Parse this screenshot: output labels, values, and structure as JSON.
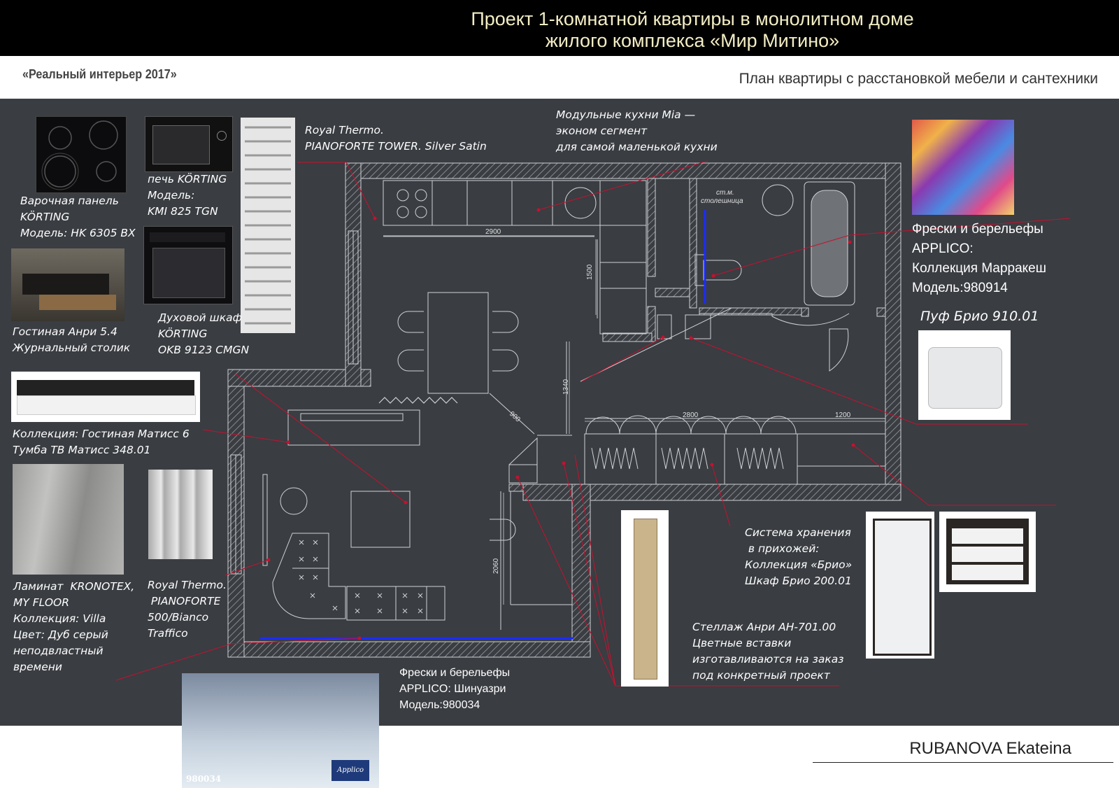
{
  "header": {
    "title_line1": "Проект 1-комнатной квартиры в монолитном доме",
    "title_line2": "жилого комплекса «Мир Митино»",
    "subtitle_left": "«Реальный интерьер 2017»",
    "subtitle_right": "План квартиры с расстановкой мебели и сантехники"
  },
  "labels": {
    "hob": "Варочная панель\nKÖRTING\nМодель: HK 6305 BX",
    "microwave": "печь KÖRTING\nМодель:\nKMI 825 TGN",
    "oven": "Духовой шкаф\nKÖRTING\nOKB 9123 CMGN",
    "radiator_tower": "Royal Thermo.\nPIANOFORTE TOWER. Silver Satin",
    "kitchen": "Модульные кухни Mia —\nэконом сегмент\nдля самой маленькой кухни",
    "frescos_bath": "Фрески и берельефы\nAPPLICO:\nКоллекция Марракеш\nМодель:980914",
    "pouf": "Пуф Брио 910.01",
    "coffee_table": "Гостиная Анри 5.4\nЖурнальный столик",
    "tv_stand": "Коллекция: Гостиная Матисс 6\nТумба ТВ Матисс 348.01",
    "laminate": "Ламинат  KRONOTEX,\nMY FLOOR\nКоллекция: Villa\nЦвет: Дуб серый\nнеподвластный\nвремени",
    "radiator": "Royal Thermo.\n PIANOFORTE\n500/Bianco\nTraffico",
    "frescos_living": "Фрески и берельефы\nAPPLICO: Шинуазри\nМодель:980034",
    "storage": "Система хранения\n в прихожей:\nКоллекция «Брио»\nШкаф Брио 200.01",
    "shelving": "Стеллаж Анри АН-701.00\nЦветные вставки\nизготавливаются на заказ\nпод конкретный проект"
  },
  "plan": {
    "dim_2900": "2900",
    "dim_1500": "1500",
    "dim_1340": "1340",
    "dim_900": "900",
    "dim_2800": "2800",
    "dim_1200": "1200",
    "dim_2060": "2060",
    "bath_note_1": "ст.м.",
    "bath_note_2": "столешница"
  },
  "images": {
    "fresco_code": "980034",
    "fresco_brand": "Applico"
  },
  "author": "RUBANOVA Ekateina",
  "colors": {
    "panel": "#3a3d42",
    "title": "#f3edc4",
    "leader": "#c8102e",
    "accent_blue": "#1a2bff"
  }
}
